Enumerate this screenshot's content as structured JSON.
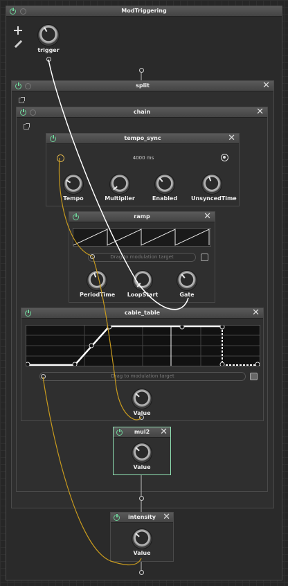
{
  "app": {
    "title": "ModTriggering"
  },
  "toolbar": {
    "add_icon": "plus-icon",
    "edit_icon": "pencil-icon"
  },
  "trigger": {
    "label": "trigger"
  },
  "split": {
    "title": "split"
  },
  "chain": {
    "title": "chain"
  },
  "tempo_sync": {
    "title": "tempo_sync",
    "value": "4000 ms",
    "knobs": [
      {
        "label": "Tempo"
      },
      {
        "label": "Multiplier"
      },
      {
        "label": "Enabled"
      },
      {
        "label": "UnsyncedTime"
      }
    ]
  },
  "ramp": {
    "title": "ramp",
    "drag_placeholder": "Drag to modulation target",
    "knobs": [
      {
        "label": "PeriodTime"
      },
      {
        "label": "LoopStart"
      },
      {
        "label": "Gate"
      }
    ]
  },
  "cable_table": {
    "title": "cable_table",
    "drag_placeholder": "Drag to modulation target",
    "knob": {
      "label": "Value"
    }
  },
  "mul2": {
    "title": "mul2",
    "knob": {
      "label": "Value"
    }
  },
  "intensity": {
    "title": "intensity",
    "knob": {
      "label": "Value"
    }
  },
  "colors": {
    "power": "#6fd39a",
    "cable_white": "#ffffff",
    "cable_orange": "#c79a1e",
    "selected_border": "#8fe0b2"
  }
}
